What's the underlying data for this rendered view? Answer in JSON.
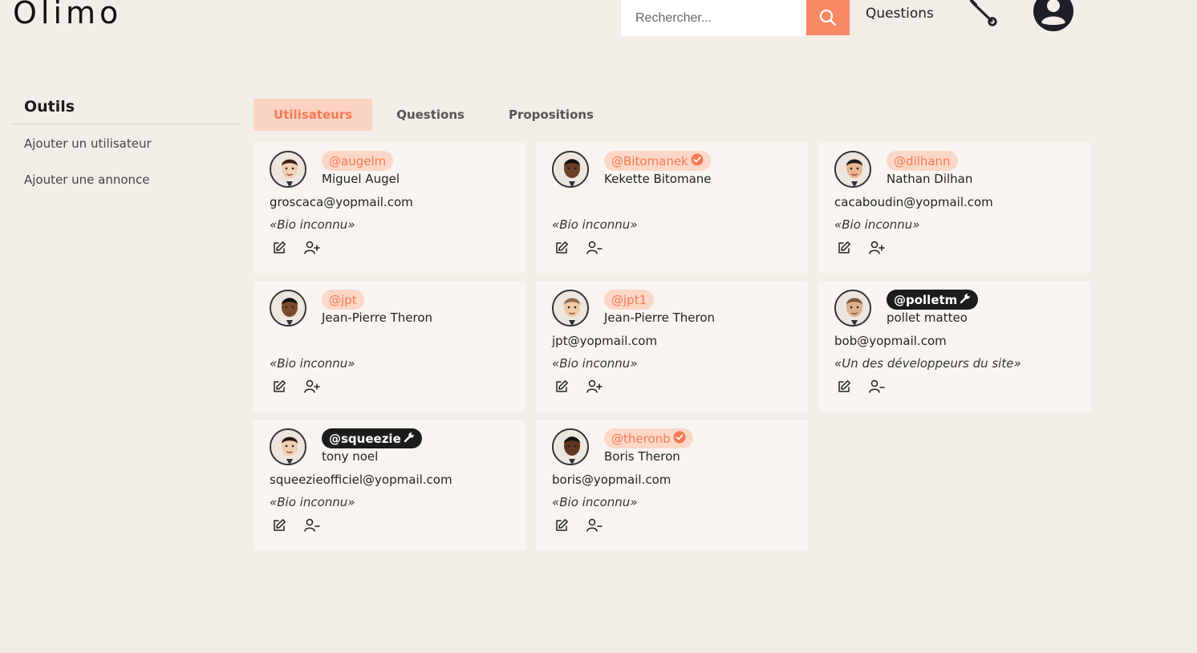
{
  "header": {
    "logo": "Olimo",
    "search_placeholder": "Rechercher...",
    "nav_questions": "Questions"
  },
  "sidebar": {
    "title": "Outils",
    "items": [
      "Ajouter un utilisateur",
      "Ajouter une annonce"
    ]
  },
  "tabs": [
    "Utilisateurs",
    "Questions",
    "Propositions"
  ],
  "colors": {
    "accent": "#f98865",
    "accent_text": "#f47a52",
    "tab_active_bg": "#fbd3c3",
    "verified": "#f47a52"
  },
  "users": [
    {
      "handle": "@augelm",
      "name": "Miguel Augel",
      "email": "groscaca@yopmail.com",
      "bio": "«Bio inconnu»",
      "badge": "",
      "role_icon": "add-user-icon"
    },
    {
      "handle": "@Bitomanek",
      "name": "Kekette Bitomane",
      "email": "",
      "bio": "«Bio inconnu»",
      "badge": "verified-icon",
      "role_icon": "remove-user-icon"
    },
    {
      "handle": "@dilhann",
      "name": "Nathan Dilhan",
      "email": "cacaboudin@yopmail.com",
      "bio": "«Bio inconnu»",
      "badge": "",
      "role_icon": "add-user-icon"
    },
    {
      "handle": "@jpt",
      "name": "Jean-Pierre Theron",
      "email": "",
      "bio": "«Bio inconnu»",
      "badge": "",
      "role_icon": "add-user-icon"
    },
    {
      "handle": "@jpt1",
      "name": "Jean-Pierre Theron",
      "email": "jpt@yopmail.com",
      "bio": "«Bio inconnu»",
      "badge": "",
      "role_icon": "add-user-icon"
    },
    {
      "handle": "@polletm",
      "name": "pollet matteo",
      "email": "bob@yopmail.com",
      "bio": "«Un des développeurs du site»",
      "badge": "wrench-icon",
      "role_icon": "remove-user-icon"
    },
    {
      "handle": "@squeezie",
      "name": "tony noel",
      "email": "squeezieofficiel@yopmail.com",
      "bio": "«Bio inconnu»",
      "badge": "wrench-icon",
      "role_icon": "remove-user-icon"
    },
    {
      "handle": "@theronb",
      "name": "Boris Theron",
      "email": "boris@yopmail.com",
      "bio": "«Bio inconnu»",
      "badge": "verified-icon",
      "role_icon": "remove-user-icon"
    }
  ]
}
